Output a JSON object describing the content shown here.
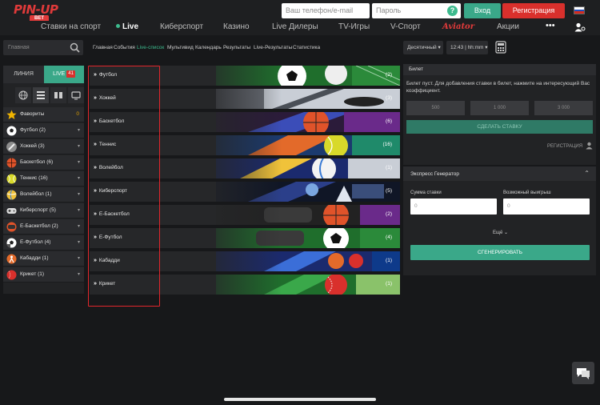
{
  "header": {
    "brand": "PIN-UP",
    "brand_sub": "BET",
    "phone_placeholder": "Ваш телефон/e-mail",
    "password_placeholder": "Пароль",
    "login": "Вход",
    "register": "Регистрация"
  },
  "nav": {
    "sports": "Ставки на спорт",
    "live": "Live",
    "esports": "Киберспорт",
    "casino": "Казино",
    "live_dealers": "Live Дилеры",
    "tv_games": "TV-Игры",
    "vsport": "V-Спорт",
    "aviator": "Aviator",
    "promo": "Акции",
    "more": "•••"
  },
  "subnav": {
    "search_placeholder": "Главная",
    "crumbs": [
      "Главная",
      "События",
      "Live-список",
      "Мультивид",
      "Календарь",
      "Результаты",
      "Live-Результаты",
      "Статистика"
    ],
    "odds_format": "Десятичный",
    "time_format": "12:43 | hh:mm"
  },
  "sidebar": {
    "tab_line": "ЛИНИЯ",
    "tab_live": "LIVE",
    "live_count": "41",
    "favorites": "Фавориты",
    "favorites_count": "0",
    "sports": [
      {
        "name": "Футбол (2)",
        "color": "#ffffff"
      },
      {
        "name": "Хоккей (3)",
        "color": "#b9b9b9"
      },
      {
        "name": "Баскетбол (6)",
        "color": "#e0532a"
      },
      {
        "name": "Теннис (16)",
        "color": "#d8d92a"
      },
      {
        "name": "Волейбол (1)",
        "color": "#f0c23a"
      },
      {
        "name": "Киберспорт (5)",
        "color": "#dddddd"
      },
      {
        "name": "E-Баскетбол (2)",
        "color": "#e0532a"
      },
      {
        "name": "E-Футбол (4)",
        "color": "#ffffff"
      },
      {
        "name": "Кабадди (1)",
        "color": "#e36a2a"
      },
      {
        "name": "Крикет (1)",
        "color": "#d9302c"
      }
    ]
  },
  "events": [
    {
      "name": "Футбол",
      "count": "(2)"
    },
    {
      "name": "Хоккей",
      "count": "(3)"
    },
    {
      "name": "Баскетбол",
      "count": "(6)"
    },
    {
      "name": "Теннис",
      "count": "(16)"
    },
    {
      "name": "Волейбол",
      "count": "(1)"
    },
    {
      "name": "Киберспорт",
      "count": "(5)"
    },
    {
      "name": "E-Баскетбол",
      "count": "(2)"
    },
    {
      "name": "E-Футбол",
      "count": "(4)"
    },
    {
      "name": "Кабадди",
      "count": "(1)"
    },
    {
      "name": "Крикет",
      "count": "(1)"
    }
  ],
  "betslip": {
    "title": "Билет",
    "message": "Билет пуст. Для добавления ставки в билет, нажмите на интересующий Вас коэффициент.",
    "stakes": [
      "500",
      "1 000",
      "3 000"
    ],
    "place_bet": "СДЕЛАТЬ СТАВКУ",
    "register_link": "РЕГИСТРАЦИЯ"
  },
  "express": {
    "title": "Экспресс Генератор",
    "stake_label": "Сумма ставки",
    "win_label": "Возможный выигрыш",
    "stake_placeholder": "0",
    "win_placeholder": "0",
    "more": "Ещё",
    "generate": "СГЕНЕРИРОВАТЬ"
  },
  "colors": {
    "accent": "#3aa889",
    "danger": "#d9302c",
    "highlight_box": "#e2262c"
  }
}
